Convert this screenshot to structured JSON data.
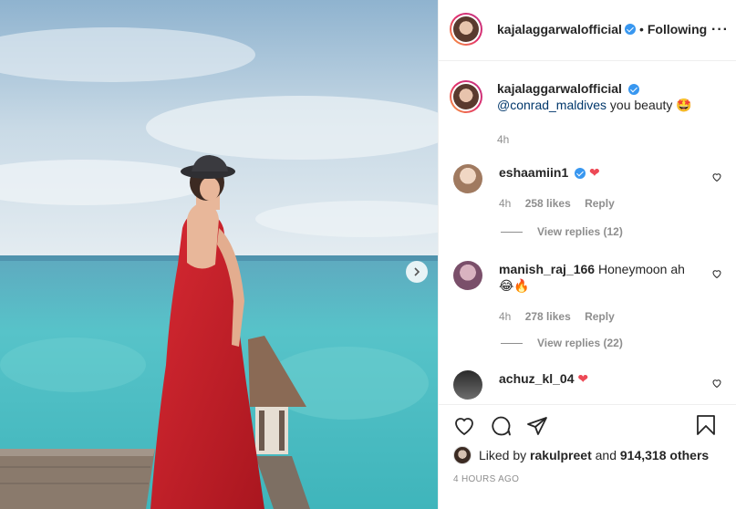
{
  "post": {
    "username": "kajalaggarwalofficial",
    "follow_status": "Following",
    "separator": "•",
    "more": "···"
  },
  "caption": {
    "username": "kajalaggarwalofficial",
    "mention": "@conrad_maldives",
    "text": " you beauty",
    "emoji": "🤩",
    "time": "4h"
  },
  "comments": [
    {
      "username": "eshaamiin1",
      "verified": true,
      "text": "",
      "heart": "❤",
      "time": "4h",
      "likes": "258 likes",
      "reply": "Reply",
      "view_replies": "View replies (12)"
    },
    {
      "username": "manish_raj_166",
      "verified": false,
      "text": "Honeymoon ah",
      "line2": "😂🔥",
      "time": "4h",
      "likes": "278 likes",
      "reply": "Reply",
      "view_replies": "View replies (22)"
    },
    {
      "username": "achuz_kl_04",
      "verified": false,
      "text": "",
      "heart": "❤"
    }
  ],
  "likes": {
    "prefix": "Liked by ",
    "user": "rakulpreet",
    "middle": " and ",
    "others": "914,318 others"
  },
  "post_time": "4 HOURS AGO",
  "icons": [
    "heart-icon",
    "comment-icon",
    "share-icon",
    "bookmark-icon",
    "chevron-right-icon",
    "verified-badge-icon"
  ],
  "colors": {
    "accent": "#3897f0",
    "like_red": "#ed4956",
    "muted": "#8e8e8e",
    "dress_red": "#c8232c"
  }
}
